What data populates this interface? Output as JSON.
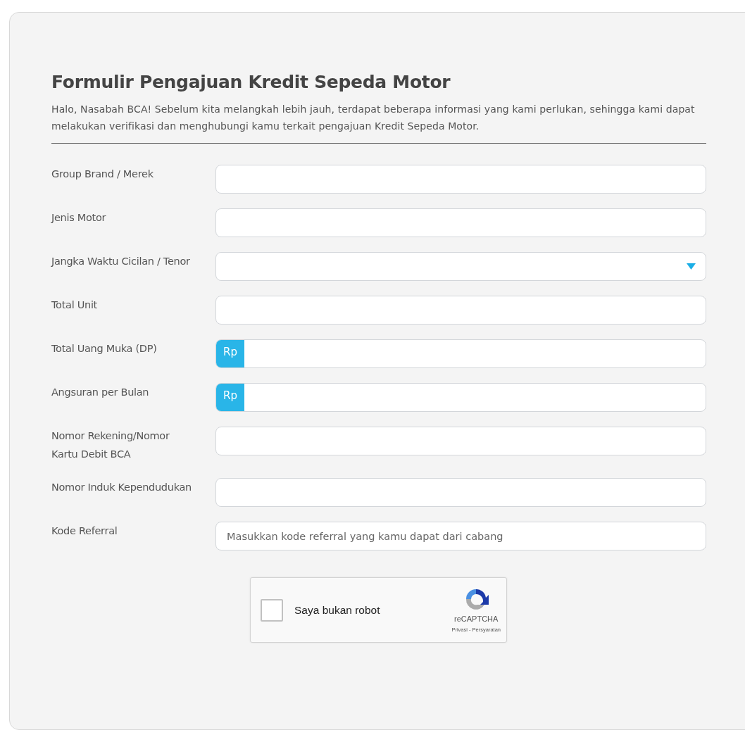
{
  "form": {
    "title": "Formulir Pengajuan Kredit Sepeda Motor",
    "intro": "Halo, Nasabah BCA! Sebelum kita melangkah lebih jauh, terdapat beberapa informasi yang kami perlukan, sehingga kami dapat melakukan verifikasi dan menghubungi kamu terkait pengajuan Kredit Sepeda Motor.",
    "fields": [
      {
        "label": "Group Brand / Merek",
        "kind": "text"
      },
      {
        "label": "Jenis Motor",
        "kind": "text"
      },
      {
        "label": "Jangka Waktu Cicilan / Tenor",
        "kind": "select"
      },
      {
        "label": "Total Unit",
        "kind": "text"
      },
      {
        "label": "Total Uang Muka (DP)",
        "kind": "currency",
        "prefix": "Rp"
      },
      {
        "label": "Angsuran per Bulan",
        "kind": "currency",
        "prefix": "Rp"
      },
      {
        "label": "Nomor Rekening/Nomor Kartu Debit BCA",
        "kind": "text"
      },
      {
        "label": "Nomor Induk Kependudukan",
        "kind": "text"
      },
      {
        "label": "Kode Referral",
        "kind": "text",
        "placeholder": "Masukkan kode referral yang kamu dapat dari cabang"
      }
    ]
  },
  "captcha": {
    "label": "Saya bukan robot",
    "checked": false,
    "brand": "reCAPTCHA",
    "links": "Privasi - Persyaratan"
  }
}
